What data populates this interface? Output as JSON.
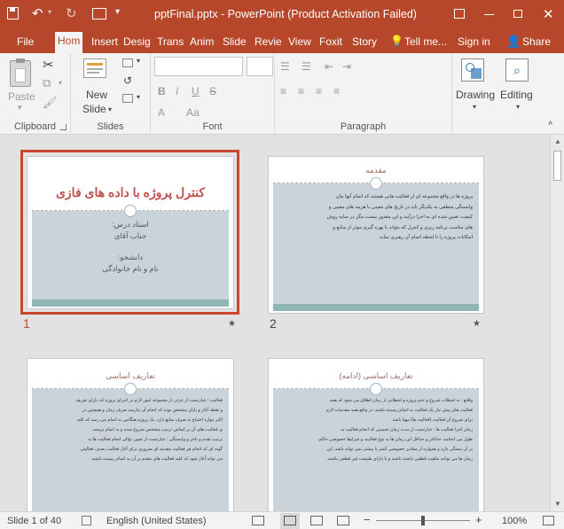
{
  "window": {
    "title": "pptFinal.pptx - PowerPoint (Product Activation Failed)"
  },
  "tabs": [
    {
      "label": "File"
    },
    {
      "label": "Hom"
    },
    {
      "label": "Insert"
    },
    {
      "label": "Desig"
    },
    {
      "label": "Trans"
    },
    {
      "label": "Anim"
    },
    {
      "label": "Slide"
    },
    {
      "label": "Revie"
    },
    {
      "label": "View"
    },
    {
      "label": "Foxit"
    },
    {
      "label": "Story"
    },
    {
      "label": "Tell me..."
    },
    {
      "label": "Sign in"
    },
    {
      "label": "Share"
    }
  ],
  "ribbon": {
    "paste": "Paste",
    "new_slide_1": "New",
    "new_slide_2": "Slide",
    "drawing": "Drawing",
    "editing": "Editing",
    "groups": {
      "clipboard": "Clipboard",
      "slides": "Slides",
      "font": "Font",
      "paragraph": "Paragraph"
    }
  },
  "slides": [
    {
      "number": "1",
      "title": "کنترل پروژه با داده های فازی",
      "lines": [
        "استاد درس:",
        "جناب آقای",
        "",
        "دانشجو:",
        "نام و نام خانوادگی"
      ]
    },
    {
      "number": "2",
      "title": "مقدمه",
      "lines": [
        "پروژه ها در واقع مجموعه ای از فعالیت هایی هستند که اتمام آنها بیان",
        "وابستگی منطقی به یکدیگر باید در تاریخ های معینی با هزینه های معینی و",
        "کیفیت تعیین شده ای به اجرا درآیند و این مقدور نیست مگر در سایه روش",
        "های مناسب برنامه ریزی و کنترل که بتواند با بهره گیری موثر از منابع و",
        "امکانات پروژه را تا لحظه اتمام آن رهبری نماید."
      ]
    },
    {
      "number": "3",
      "title": "تعاریف اساسی",
      "lines": [
        "فعالیت : عبارتست از جزئی از مجموعه امور لازم در اجرای پروژه که دارای تعریف",
        "و نقطه آغاز و پایان مشخص بوده که انجام آن نیازمند صرف زمان و همچنین در",
        "اکثر موارد احتیاج به صرف منابع دارد. یک پروژه هنگامی به اتمام می رسد که کلیه",
        "ی فعالیت های آن بر اساس ترتیب مشخص شروع شده و به اتمام برسند.",
        "ترتیب تقدم و تاخر و وابستگی : عبارتست از تعیین توالی انجام فعالیت ها به",
        "گونه ای که انجام هر فعالیت مقدمه ای ضروری برای آغاز فعالیت بعدی، فعالیتی",
        "می تواند آغاز شود که کلیه فعالیت های مقدم بر آن به اتمام رسیده باشند."
      ]
    },
    {
      "number": "4",
      "title": "تعاریف اساسی (ادامه)",
      "lines": [
        "وقایع : به لحظات شروع و ختم پروژه و لحظاتی از زمان اطلاق می شود که همه",
        "فعالیت های پیش نیاز یک فعالیت به اتمام رسیده باشند. در واقع همه مقدمات لازم",
        "برای شروع آن فعالیت (فعالیت ها) مهیا باشد.",
        "زمان اجرا فعالیت ها : عبارتست از مدت زمان تخمینی که انجام فعالیت به",
        "طول می انجامد. حداکثر و حداقل این زمان ها به نوع فعالیت و شرایط خصوصی حاکم",
        "بر آن بستگی دارد و همواره از مقادیر خصوصی کمتر یا بیشتر نمی تواند باشد. این",
        "زمان ها می توانند ماهیت قطعی داشته باشند و یا دارای طبیعت غیر قطعی باشند."
      ]
    }
  ],
  "status": {
    "slide_info": "Slide 1 of 40",
    "language": "English (United States)",
    "zoom": "100%",
    "zoom_fraction": 0.5
  },
  "colors": {
    "accent": "#b7472a",
    "selection": "#c9472f",
    "slide_body": "#c9d3d9",
    "slide_band": "#8fb5b5"
  }
}
